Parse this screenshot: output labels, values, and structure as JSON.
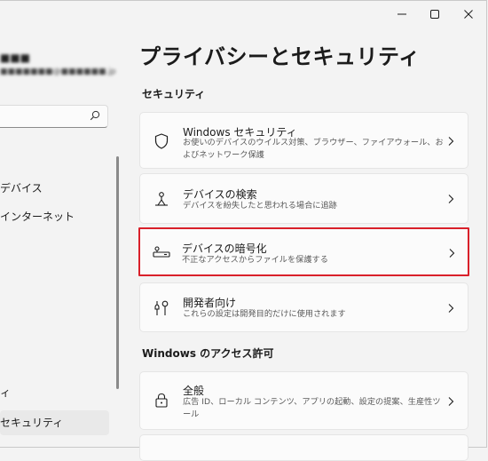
{
  "window": {
    "controls": [
      "minimize-icon",
      "maximize-icon",
      "close-icon"
    ]
  },
  "sidebar": {
    "user_name": "■■■",
    "user_email": "■■■■■■■@■■■■■■.jp",
    "search_placeholder": "",
    "nav": {
      "devices": "デバイス",
      "network": "インターネット",
      "item_partial": "ィ",
      "security": "セキュリティ"
    }
  },
  "main": {
    "page_title": "プライバシーとセキュリティ",
    "section_security": "セキュリティ",
    "section_windows_access": "Windows のアクセス許可",
    "cards": [
      {
        "title": "Windows セキュリティ",
        "description": "お使いのデバイスのウイルス対策、ブラウザー、ファイアウォール、およびネットワーク保護",
        "icon": "shield-icon"
      },
      {
        "title": "デバイスの検索",
        "description": "デバイスを紛失したと思われる場合に追跡",
        "icon": "person-location-icon"
      },
      {
        "title": "デバイスの暗号化",
        "description": "不正なアクセスからファイルを保護する",
        "icon": "encryption-key-icon"
      },
      {
        "title": "開発者向け",
        "description": "これらの設定は開発目的だけに使用されます",
        "icon": "developer-tools-icon"
      },
      {
        "title": "全般",
        "description": "広告 ID、ローカル コンテンツ、アプリの起動、設定の提案、生産性ツール",
        "icon": "lock-icon"
      }
    ],
    "highlight_color": "#d9202a"
  }
}
